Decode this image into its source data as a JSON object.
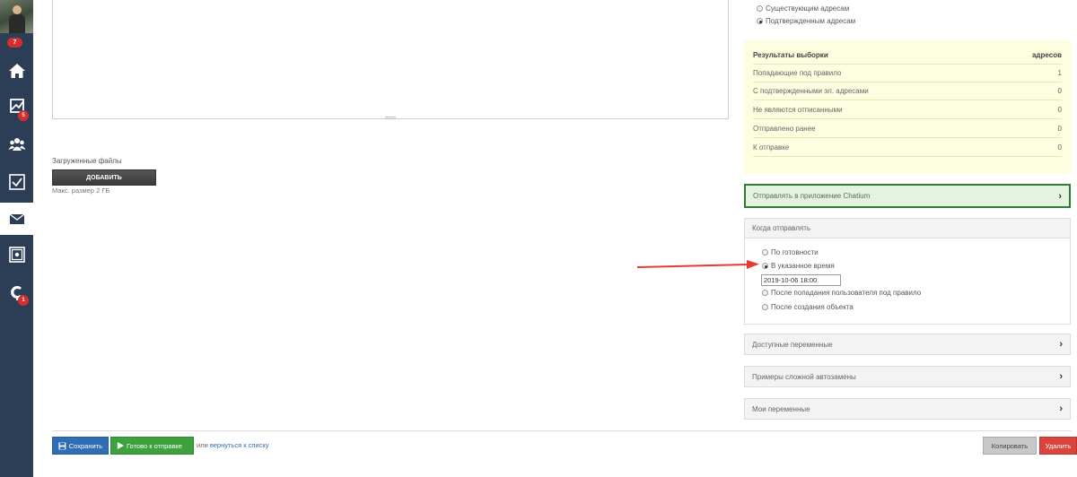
{
  "sidebar": {
    "top_badge": "7",
    "items": [
      {
        "icon": "home-icon",
        "badge": ""
      },
      {
        "icon": "chart-icon",
        "badge": "5"
      },
      {
        "icon": "users-icon",
        "badge": ""
      },
      {
        "icon": "checkbox-icon",
        "badge": ""
      },
      {
        "icon": "mail-icon",
        "badge": ""
      },
      {
        "icon": "safe-icon",
        "badge": ""
      },
      {
        "icon": "chatium-logo-icon",
        "badge": "1"
      }
    ]
  },
  "uploads": {
    "label": "Загруженные файлы",
    "add_button": "ДОБАВИТЬ",
    "max_size": "Макс. размер 2 ГБ"
  },
  "address_filter": {
    "options": [
      {
        "label": "Существующим адресам",
        "checked": false
      },
      {
        "label": "Подтвержденным адресам",
        "checked": true
      }
    ]
  },
  "results": {
    "header": {
      "label": "Результаты выборки",
      "value": "адресов"
    },
    "rows": [
      {
        "label": "Попадающие под правило",
        "value": "1"
      },
      {
        "label": "С подтвержденными эл. адресами",
        "value": "0"
      },
      {
        "label": "Не являются отписанными",
        "value": "0"
      },
      {
        "label": "Отправлено ранее",
        "value": "0"
      },
      {
        "label": "К отправке",
        "value": "0"
      }
    ]
  },
  "chatium": {
    "label": "Отправлять в приложение Chatium"
  },
  "when": {
    "title": "Когда отправлять",
    "options": [
      {
        "label": "По готовности",
        "checked": false
      },
      {
        "label": "В указанное время",
        "checked": true
      },
      {
        "label": "После попадания пользователя под правило",
        "checked": false
      },
      {
        "label": "После создания объекта",
        "checked": false
      }
    ],
    "datetime": "2019-10-06 18:00"
  },
  "panels": {
    "variables": "Доступные переменные",
    "examples": "Примеры сложной автозамены",
    "my_variables": "Мои переменные"
  },
  "footer": {
    "save": "Сохранить",
    "ready": "Готово к отправке",
    "or": "или",
    "back": "вернуться к списку",
    "copy": "Копировать",
    "delete": "Удалить"
  },
  "colors": {
    "sidebar": "#2c3e55",
    "save": "#2f6db5",
    "ready": "#3da23d",
    "delete": "#d9443c",
    "arrow": "#e53935"
  }
}
